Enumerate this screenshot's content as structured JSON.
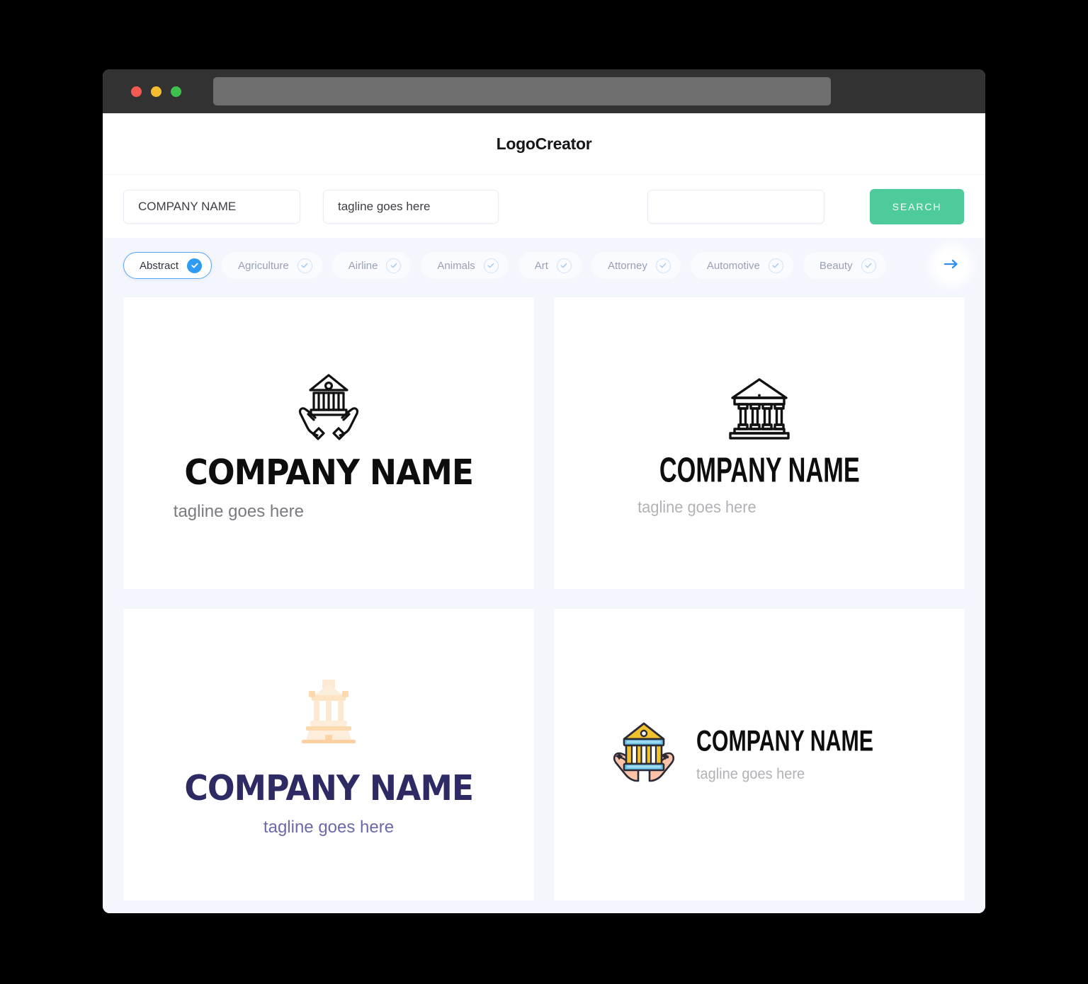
{
  "window": {
    "traffic_lights": [
      "close",
      "minimize",
      "maximize"
    ],
    "url_value": ""
  },
  "header": {
    "brand": "LogoCreator"
  },
  "search": {
    "company_value": "COMPANY NAME",
    "company_placeholder": "COMPANY NAME",
    "tagline_value": "tagline goes here",
    "tagline_placeholder": "tagline goes here",
    "keyword_value": "",
    "keyword_placeholder": "",
    "search_label": "SEARCH"
  },
  "categories": {
    "items": [
      {
        "label": "Abstract",
        "selected": true
      },
      {
        "label": "Agriculture",
        "selected": false
      },
      {
        "label": "Airline",
        "selected": false
      },
      {
        "label": "Animals",
        "selected": false
      },
      {
        "label": "Art",
        "selected": false
      },
      {
        "label": "Attorney",
        "selected": false
      },
      {
        "label": "Automotive",
        "selected": false
      },
      {
        "label": "Beauty",
        "selected": false
      }
    ],
    "next_arrow": "arrow-right-icon"
  },
  "logos": [
    {
      "id": "logo-1",
      "name": "COMPANY NAME",
      "tagline": "tagline goes here",
      "icon": "bank-in-hands-outline-icon",
      "layout": "stacked",
      "name_color": "#0d0d0d",
      "tagline_color": "#7a7a80"
    },
    {
      "id": "logo-2",
      "name": "COMPANY NAME",
      "tagline": "tagline goes here",
      "icon": "bank-building-outline-icon",
      "layout": "stacked",
      "name_color": "#0d0d0d",
      "tagline_color": "#b2b2b6"
    },
    {
      "id": "logo-3",
      "name": "COMPANY NAME",
      "tagline": "tagline goes here",
      "icon": "bank-building-peach-flat-icon",
      "layout": "stacked",
      "name_color": "#2e2a63",
      "tagline_color": "#6b6aa8"
    },
    {
      "id": "logo-4",
      "name": "COMPANY NAME",
      "tagline": "tagline goes here",
      "icon": "bank-in-hands-color-icon",
      "layout": "horizontal",
      "name_color": "#0d0d0d",
      "tagline_color": "#b2b2b6"
    }
  ],
  "colors": {
    "page_background": "#f4f6fd",
    "card_background": "#ffffff",
    "titlebar": "#323232",
    "url_bar": "#6e6e6e",
    "search_button": "#4ecb9b",
    "chip_selected_border": "#57a5f5",
    "chip_check_fill": "#2e9bf4",
    "chip_text": "#98a0b4",
    "icon_gold": "#f2c12e",
    "icon_blue": "#6bc5e8",
    "icon_skin": "#fcc3a8",
    "icon_outline": "#2b2b38",
    "icon_peach": "#fbe2c8"
  }
}
